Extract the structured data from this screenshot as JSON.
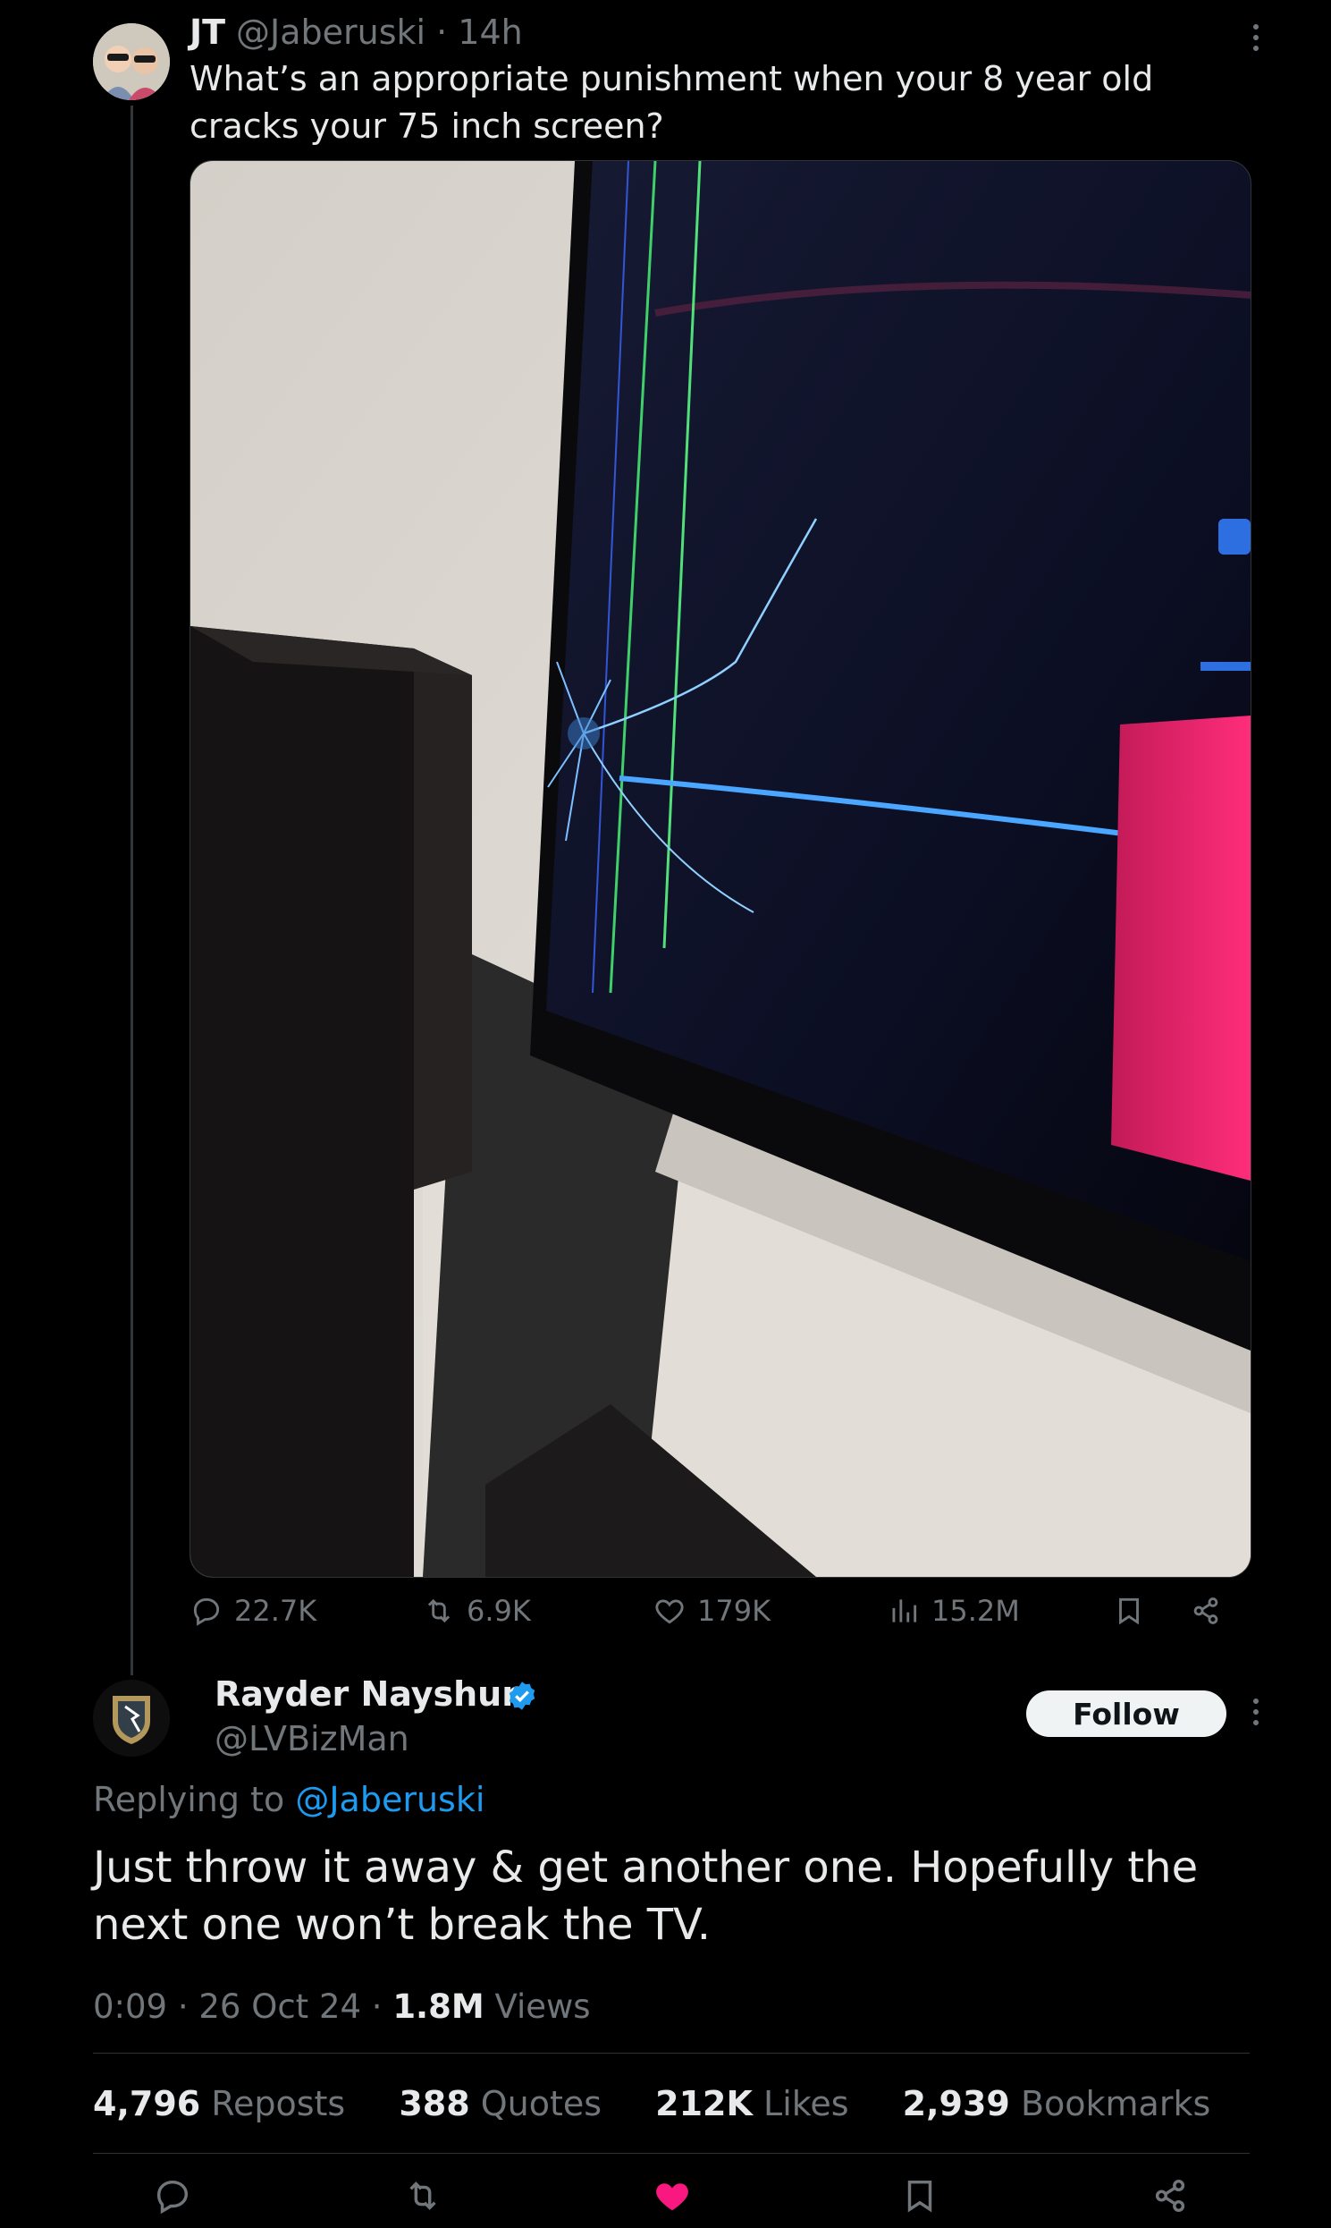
{
  "tweet": {
    "author_name": "JT",
    "handle_time": "@Jaberuski · 14h",
    "text": "What’s an appropriate punishment when your 8 year old cracks your 75 inch screen?",
    "actions": {
      "replies": "22.7K",
      "reposts": "6.9K",
      "likes": "179K",
      "views": "15.2M"
    }
  },
  "reply": {
    "author_name": "Rayder Nayshun",
    "handle": "@LVBizMan",
    "follow_label": "Follow",
    "replying_prefix": "Replying to",
    "replying_to": "@Jaberuski",
    "text": "Just throw it away & get another one. Hopefully the next one won’t break the TV.",
    "time": "0:09 · 26 Oct 24 · ",
    "views_count": "1.8M",
    "views_label": " Views",
    "stats": {
      "reposts_count": "4,796",
      "reposts_label": " Reposts",
      "quotes_count": "388",
      "quotes_label": " Quotes",
      "likes_count": "212K",
      "likes_label": " Likes",
      "bookmarks_count": "2,939",
      "bookmarks_label": " Bookmarks"
    },
    "liked": true
  },
  "colors": {
    "background": "#000000",
    "text": "#e7e9ea",
    "muted": "#71767b",
    "link": "#1d9bf0",
    "like_active": "#f91880",
    "verified": "#1d9bf0"
  },
  "icons": [
    "more-icon",
    "reply-icon",
    "repost-icon",
    "like-icon",
    "views-icon",
    "bookmark-icon",
    "share-icon",
    "verified-badge-icon"
  ]
}
